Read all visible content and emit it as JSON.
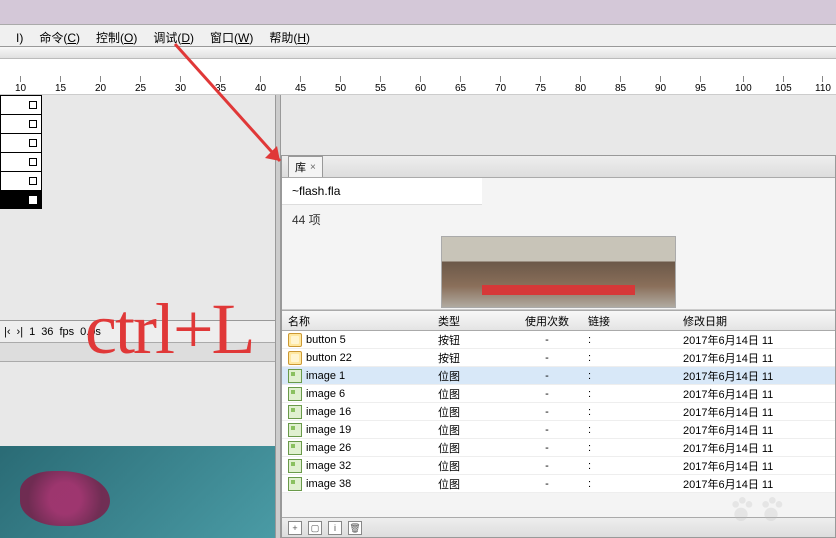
{
  "menu": {
    "items": [
      {
        "label": "I)",
        "key": ""
      },
      {
        "label": "命令",
        "key": "C"
      },
      {
        "label": "控制",
        "key": "O"
      },
      {
        "label": "调试",
        "key": "D"
      },
      {
        "label": "窗口",
        "key": "W"
      },
      {
        "label": "帮助",
        "key": "H"
      }
    ]
  },
  "ruler": {
    "ticks": [
      10,
      15,
      20,
      25,
      30,
      35,
      40,
      45,
      50,
      55,
      60,
      65,
      70,
      75,
      80,
      85,
      90,
      95,
      100,
      105,
      110
    ]
  },
  "timebar": {
    "frame": "1",
    "fps_val": "36",
    "fps_label": "fps",
    "time": "0.0s"
  },
  "library": {
    "tab_label": "库",
    "doc_name": "~flash.fla",
    "item_count": "44 项",
    "columns": {
      "name": "名称",
      "type": "类型",
      "use": "使用次数",
      "link": "链接",
      "date": "修改日期"
    },
    "rows": [
      {
        "icon": "btn",
        "name": "button 5",
        "type": "按钮",
        "use": "-",
        "link": ":",
        "date": "2017年6月14日  11"
      },
      {
        "icon": "btn",
        "name": "button 22",
        "type": "按钮",
        "use": "-",
        "link": ":",
        "date": "2017年6月14日  11"
      },
      {
        "icon": "bmp",
        "name": "image 1",
        "type": "位图",
        "use": "-",
        "link": ":",
        "date": "2017年6月14日  11",
        "sel": true
      },
      {
        "icon": "bmp",
        "name": "image 6",
        "type": "位图",
        "use": "-",
        "link": ":",
        "date": "2017年6月14日  11"
      },
      {
        "icon": "bmp",
        "name": "image 16",
        "type": "位图",
        "use": "-",
        "link": ":",
        "date": "2017年6月14日  11"
      },
      {
        "icon": "bmp",
        "name": "image 19",
        "type": "位图",
        "use": "-",
        "link": ":",
        "date": "2017年6月14日  11"
      },
      {
        "icon": "bmp",
        "name": "image 26",
        "type": "位图",
        "use": "-",
        "link": ":",
        "date": "2017年6月14日  11"
      },
      {
        "icon": "bmp",
        "name": "image 32",
        "type": "位图",
        "use": "-",
        "link": ":",
        "date": "2017年6月14日  11"
      },
      {
        "icon": "bmp",
        "name": "image 38",
        "type": "位图",
        "use": "-",
        "link": ":",
        "date": "2017年6月14日  11"
      }
    ]
  },
  "annotation": {
    "text": "ctrl+L"
  }
}
